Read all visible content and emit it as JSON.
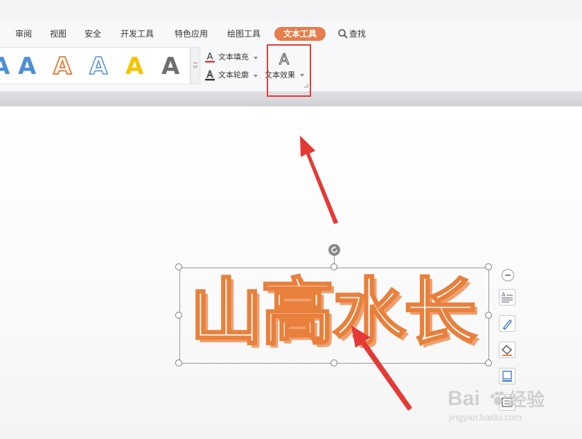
{
  "menu": {
    "tabs": [
      "审阅",
      "视图",
      "安全",
      "开发工具",
      "特色应用",
      "绘图工具"
    ],
    "active_tab": "文本工具",
    "search_label": "查找"
  },
  "ribbon": {
    "gallery_letter": "A",
    "text_fill_label": "文本填充",
    "text_outline_label": "文本轮廓",
    "text_effect_label": "文本效果",
    "text_fill_color": "#e53935"
  },
  "canvas": {
    "wordart_text": "山高水长",
    "wordart_color": "#e8803c"
  },
  "watermark": {
    "brand": "Bai",
    "brand_tail": "经验",
    "url": "jingyan.baidu.com"
  },
  "colors": {
    "accent": "#e77d4a",
    "highlight": "#e53935"
  }
}
